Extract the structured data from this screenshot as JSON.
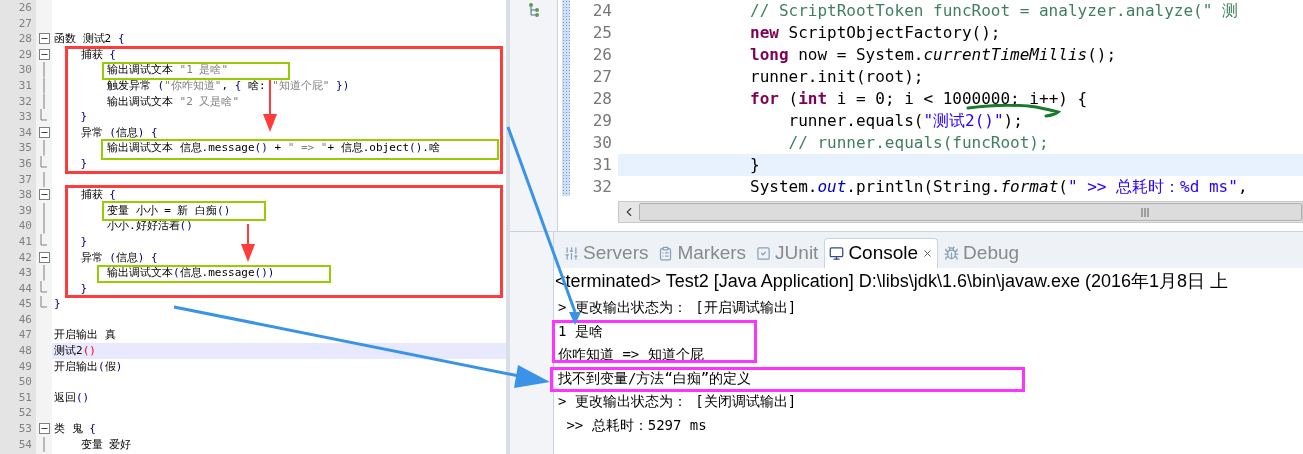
{
  "script_editor": {
    "lines": [
      {
        "number": "26",
        "current": false,
        "kind": "plain"
      },
      {
        "number": "27",
        "current": false,
        "kind": "plain"
      },
      {
        "number": "28",
        "current": false,
        "kind": "open",
        "tokens": [
          {
            "kind": "plain",
            "text": "函数 测试2 "
          },
          {
            "kind": "brace",
            "text": "{"
          }
        ]
      },
      {
        "number": "29",
        "current": false,
        "kind": "open",
        "tokens": [
          {
            "kind": "plain",
            "text": "    捕获 "
          },
          {
            "kind": "brace",
            "text": "{"
          }
        ]
      },
      {
        "number": "30",
        "current": false,
        "kind": "inner",
        "tokens": [
          {
            "kind": "plain",
            "text": "        输出调试文本 "
          },
          {
            "kind": "string",
            "text": "\"1 是啥\""
          }
        ]
      },
      {
        "number": "31",
        "current": false,
        "kind": "inner",
        "tokens": [
          {
            "kind": "plain",
            "text": "        触发异常 "
          },
          {
            "kind": "brace",
            "text": "("
          },
          {
            "kind": "string",
            "text": "\"你咋知道\""
          },
          {
            "kind": "plain",
            "text": ", "
          },
          {
            "kind": "brace",
            "text": "{"
          },
          {
            "kind": "plain",
            "text": " 啥: "
          },
          {
            "kind": "string",
            "text": "\"知道个屁\""
          },
          {
            "kind": "brace",
            "text": " })"
          }
        ]
      },
      {
        "number": "32",
        "current": false,
        "kind": "inner",
        "tokens": [
          {
            "kind": "plain",
            "text": "        输出调试文本 "
          },
          {
            "kind": "string",
            "text": "\"2 又是啥\""
          }
        ]
      },
      {
        "number": "33",
        "current": false,
        "kind": "close",
        "tokens": [
          {
            "kind": "brace",
            "text": "    }"
          }
        ]
      },
      {
        "number": "34",
        "current": false,
        "kind": "open",
        "tokens": [
          {
            "kind": "plain",
            "text": "    异常 "
          },
          {
            "kind": "brace",
            "text": "("
          },
          {
            "kind": "plain",
            "text": "信息"
          },
          {
            "kind": "brace",
            "text": ") {"
          }
        ]
      },
      {
        "number": "35",
        "current": false,
        "kind": "inner",
        "tokens": [
          {
            "kind": "plain",
            "text": "        输出调试文本 信息.message"
          },
          {
            "kind": "brace",
            "text": "()"
          },
          {
            "kind": "plain",
            "text": " + "
          },
          {
            "kind": "string",
            "text": "\" => \""
          },
          {
            "kind": "plain",
            "text": "+ 信息.object"
          },
          {
            "kind": "brace",
            "text": "()"
          },
          {
            "kind": "plain",
            "text": ".啥"
          }
        ]
      },
      {
        "number": "36",
        "current": false,
        "kind": "close",
        "tokens": [
          {
            "kind": "brace",
            "text": "    }"
          }
        ]
      },
      {
        "number": "37",
        "current": false,
        "kind": "inner"
      },
      {
        "number": "38",
        "current": false,
        "kind": "open",
        "tokens": [
          {
            "kind": "plain",
            "text": "    捕获 "
          },
          {
            "kind": "brace",
            "text": "{"
          }
        ]
      },
      {
        "number": "39",
        "current": false,
        "kind": "inner",
        "tokens": [
          {
            "kind": "plain",
            "text": "        变量 小小 = 新 白痴"
          },
          {
            "kind": "brace",
            "text": "()"
          }
        ]
      },
      {
        "number": "40",
        "current": false,
        "kind": "inner",
        "tokens": [
          {
            "kind": "plain",
            "text": "        小小.好好活着"
          },
          {
            "kind": "brace",
            "text": "()"
          }
        ]
      },
      {
        "number": "41",
        "current": false,
        "kind": "close",
        "tokens": [
          {
            "kind": "brace",
            "text": "    }"
          }
        ]
      },
      {
        "number": "42",
        "current": false,
        "kind": "open",
        "tokens": [
          {
            "kind": "plain",
            "text": "    异常 "
          },
          {
            "kind": "brace",
            "text": "("
          },
          {
            "kind": "plain",
            "text": "信息"
          },
          {
            "kind": "brace",
            "text": ") {"
          }
        ]
      },
      {
        "number": "43",
        "current": false,
        "kind": "inner",
        "tokens": [
          {
            "kind": "plain",
            "text": "        输出调试文本"
          },
          {
            "kind": "brace",
            "text": "("
          },
          {
            "kind": "plain",
            "text": "信息.message"
          },
          {
            "kind": "brace",
            "text": "())"
          }
        ]
      },
      {
        "number": "44",
        "current": false,
        "kind": "close",
        "tokens": [
          {
            "kind": "brace",
            "text": "    }"
          }
        ]
      },
      {
        "number": "45",
        "current": false,
        "kind": "close",
        "tokens": [
          {
            "kind": "brace",
            "text": "}"
          }
        ]
      },
      {
        "number": "46",
        "current": false,
        "kind": "plain"
      },
      {
        "number": "47",
        "current": false,
        "kind": "plain",
        "tokens": [
          {
            "kind": "plain",
            "text": "开启输出 真"
          }
        ]
      },
      {
        "number": "48",
        "current": true,
        "kind": "plain",
        "tokens": [
          {
            "kind": "plain",
            "text": "测试2"
          },
          {
            "kind": "error",
            "text": "()"
          }
        ]
      },
      {
        "number": "49",
        "current": false,
        "kind": "plain",
        "tokens": [
          {
            "kind": "plain",
            "text": "开启输出"
          },
          {
            "kind": "brace",
            "text": "("
          },
          {
            "kind": "plain",
            "text": "假"
          },
          {
            "kind": "brace",
            "text": ")"
          }
        ]
      },
      {
        "number": "50",
        "current": false,
        "kind": "plain"
      },
      {
        "number": "51",
        "current": false,
        "kind": "plain",
        "tokens": [
          {
            "kind": "plain",
            "text": "返回"
          },
          {
            "kind": "brace",
            "text": "()"
          }
        ]
      },
      {
        "number": "52",
        "current": false,
        "kind": "plain"
      },
      {
        "number": "53",
        "current": false,
        "kind": "open",
        "tokens": [
          {
            "kind": "plain",
            "text": "类 鬼 "
          },
          {
            "kind": "brace",
            "text": "{"
          }
        ]
      },
      {
        "number": "54",
        "current": false,
        "kind": "inner",
        "tokens": [
          {
            "kind": "plain",
            "text": "    变量 爱好"
          }
        ]
      }
    ]
  },
  "java_editor": {
    "lines": [
      {
        "number": "24",
        "current": false,
        "tokens": [
          {
            "kind": "comment",
            "text": "// ScriptRootToken funcRoot = analyzer.analyze(\" 测"
          }
        ]
      },
      {
        "number": "25",
        "current": false,
        "tokens": [
          {
            "kind": "keyword",
            "text": "new"
          },
          {
            "kind": "plain",
            "text": " ScriptObjectFactory();"
          }
        ]
      },
      {
        "number": "26",
        "current": false,
        "tokens": [
          {
            "kind": "keyword",
            "text": "long"
          },
          {
            "kind": "plain",
            "text": " now = System."
          },
          {
            "kind": "italic",
            "text": "currentTimeMillis"
          },
          {
            "kind": "plain",
            "text": "();"
          }
        ]
      },
      {
        "number": "27",
        "current": false,
        "tokens": [
          {
            "kind": "plain",
            "text": "runner.init(root);"
          }
        ]
      },
      {
        "number": "28",
        "current": false,
        "tokens": [
          {
            "kind": "keyword",
            "text": "for"
          },
          {
            "kind": "plain",
            "text": " ("
          },
          {
            "kind": "keyword",
            "text": "int"
          },
          {
            "kind": "plain",
            "text": " i = 0; i < 1000000; i++) {"
          }
        ]
      },
      {
        "number": "29",
        "current": false,
        "tokens": [
          {
            "kind": "plain",
            "text": "    runner.equals("
          },
          {
            "kind": "string",
            "text": "\"测试2()\""
          },
          {
            "kind": "plain",
            "text": ");"
          }
        ]
      },
      {
        "number": "30",
        "current": false,
        "tokens": [
          {
            "kind": "comment",
            "text": "    // runner.equals(funcRoot);"
          }
        ]
      },
      {
        "number": "31",
        "current": true,
        "tokens": [
          {
            "kind": "plain",
            "text": "}"
          }
        ]
      },
      {
        "number": "32",
        "current": false,
        "tokens": [
          {
            "kind": "plain",
            "text": "System."
          },
          {
            "kind": "field",
            "text": "out"
          },
          {
            "kind": "plain",
            "text": ".println(String."
          },
          {
            "kind": "italic",
            "text": "format"
          },
          {
            "kind": "plain",
            "text": "("
          },
          {
            "kind": "string",
            "text": "\" >> 总耗时：%d ms\""
          },
          {
            "kind": "plain",
            "text": ","
          }
        ]
      }
    ]
  },
  "views": {
    "tabs": [
      {
        "label": "Servers",
        "selected": false
      },
      {
        "label": "Markers",
        "selected": false
      },
      {
        "label": "JUnit",
        "selected": false
      },
      {
        "label": "Console",
        "selected": true
      },
      {
        "label": "Debug",
        "selected": false
      }
    ]
  },
  "console": {
    "status": "<terminated> Test2 [Java Application] D:\\libs\\jdk\\1.6\\bin\\javaw.exe (2016年1月8日 上",
    "lines": [
      "> 更改输出状态为： [开启调试输出]",
      "1 是啥",
      "你咋知道 => 知道个屁",
      "找不到变量/方法“白痴”的定义",
      "> 更改输出状态为： [关闭调试输出]",
      " >> 总耗时：5297 ms"
    ]
  }
}
